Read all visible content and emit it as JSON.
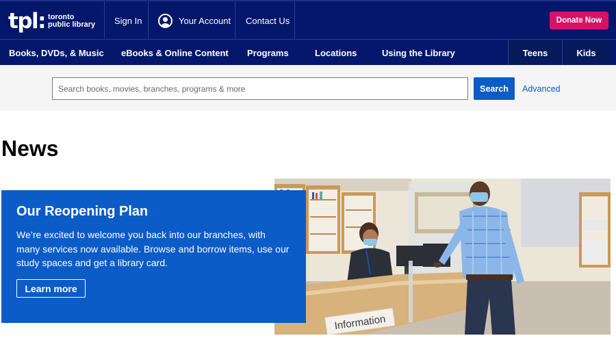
{
  "header": {
    "logo": {
      "mark": "tpl:",
      "line1": "toronto",
      "line2": "public library"
    },
    "sign_in": "Sign In",
    "your_account": "Your Account",
    "contact_us": "Contact Us",
    "donate": "Donate Now"
  },
  "nav": {
    "items": [
      "Books, DVDs, & Music",
      "eBooks & Online Content",
      "Programs",
      "Locations",
      "Using the Library"
    ],
    "teens": "Teens",
    "kids": "Kids"
  },
  "search": {
    "placeholder": "Search books, movies, branches, programs & more",
    "button": "Search",
    "advanced": "Advanced"
  },
  "page": {
    "title": "News"
  },
  "promo": {
    "title": "Our Reopening Plan",
    "text": "We’re excited to welcome you back into our branches, with many services now available. Browse and borrow items, use our study spaces and get a library card.",
    "button": "Learn more"
  },
  "photo": {
    "sign_text": "Information"
  },
  "colors": {
    "header_bg": "#04176b",
    "donate": "#d41367",
    "accent": "#0b5cc7",
    "search_band": "#f5f5f5"
  }
}
